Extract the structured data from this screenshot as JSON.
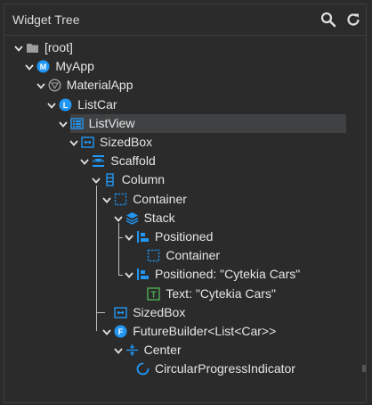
{
  "panel": {
    "title": "Widget Tree",
    "search_icon": "search-icon",
    "refresh_icon": "refresh-icon"
  },
  "tree": [
    {
      "label": "[root]",
      "icon": "folder-icon",
      "depth": 0,
      "expanded": true
    },
    {
      "label": "MyApp",
      "icon": "material-app-widget-icon",
      "depth": 1,
      "expanded": true
    },
    {
      "label": "MaterialApp",
      "icon": "material-logo-icon",
      "depth": 2,
      "expanded": true
    },
    {
      "label": "ListCar",
      "icon": "stateless-widget-icon",
      "depth": 3,
      "expanded": true
    },
    {
      "label": "ListView",
      "icon": "list-view-icon",
      "depth": 4,
      "expanded": true,
      "selected": true
    },
    {
      "label": "SizedBox",
      "icon": "sized-box-icon",
      "depth": 5,
      "expanded": true
    },
    {
      "label": "Scaffold",
      "icon": "scaffold-icon",
      "depth": 6,
      "expanded": true
    },
    {
      "label": "Column",
      "icon": "column-icon",
      "depth": 7,
      "expanded": true
    },
    {
      "label": "Container",
      "icon": "container-icon",
      "depth": 8,
      "expanded": true
    },
    {
      "label": "Stack",
      "icon": "stack-icon",
      "depth": 9,
      "expanded": true
    },
    {
      "label": "Positioned",
      "icon": "positioned-icon",
      "depth": 10,
      "expanded": true
    },
    {
      "label": "Container",
      "icon": "container-icon",
      "depth": 11,
      "expanded": false
    },
    {
      "label": "Positioned: \"Cytekia Cars\"",
      "icon": "positioned-icon",
      "depth": 10,
      "expanded": true
    },
    {
      "label": "Text: \"Cytekia Cars\"",
      "icon": "text-icon",
      "depth": 11,
      "expanded": false
    },
    {
      "label": "SizedBox",
      "icon": "sized-box-icon",
      "depth": 8,
      "expanded": false
    },
    {
      "label": "FutureBuilder<List<Car>>",
      "icon": "future-builder-icon",
      "depth": 8,
      "expanded": true
    },
    {
      "label": "Center",
      "icon": "center-icon",
      "depth": 9,
      "expanded": true
    },
    {
      "label": "CircularProgressIndicator",
      "icon": "circular-progress-icon",
      "depth": 10,
      "expanded": false
    }
  ],
  "colors": {
    "accent_blue": "#2196f3",
    "text_green": "#4caf50",
    "folder_gray": "#9e9e9e",
    "selected_row": "#3f4143"
  }
}
